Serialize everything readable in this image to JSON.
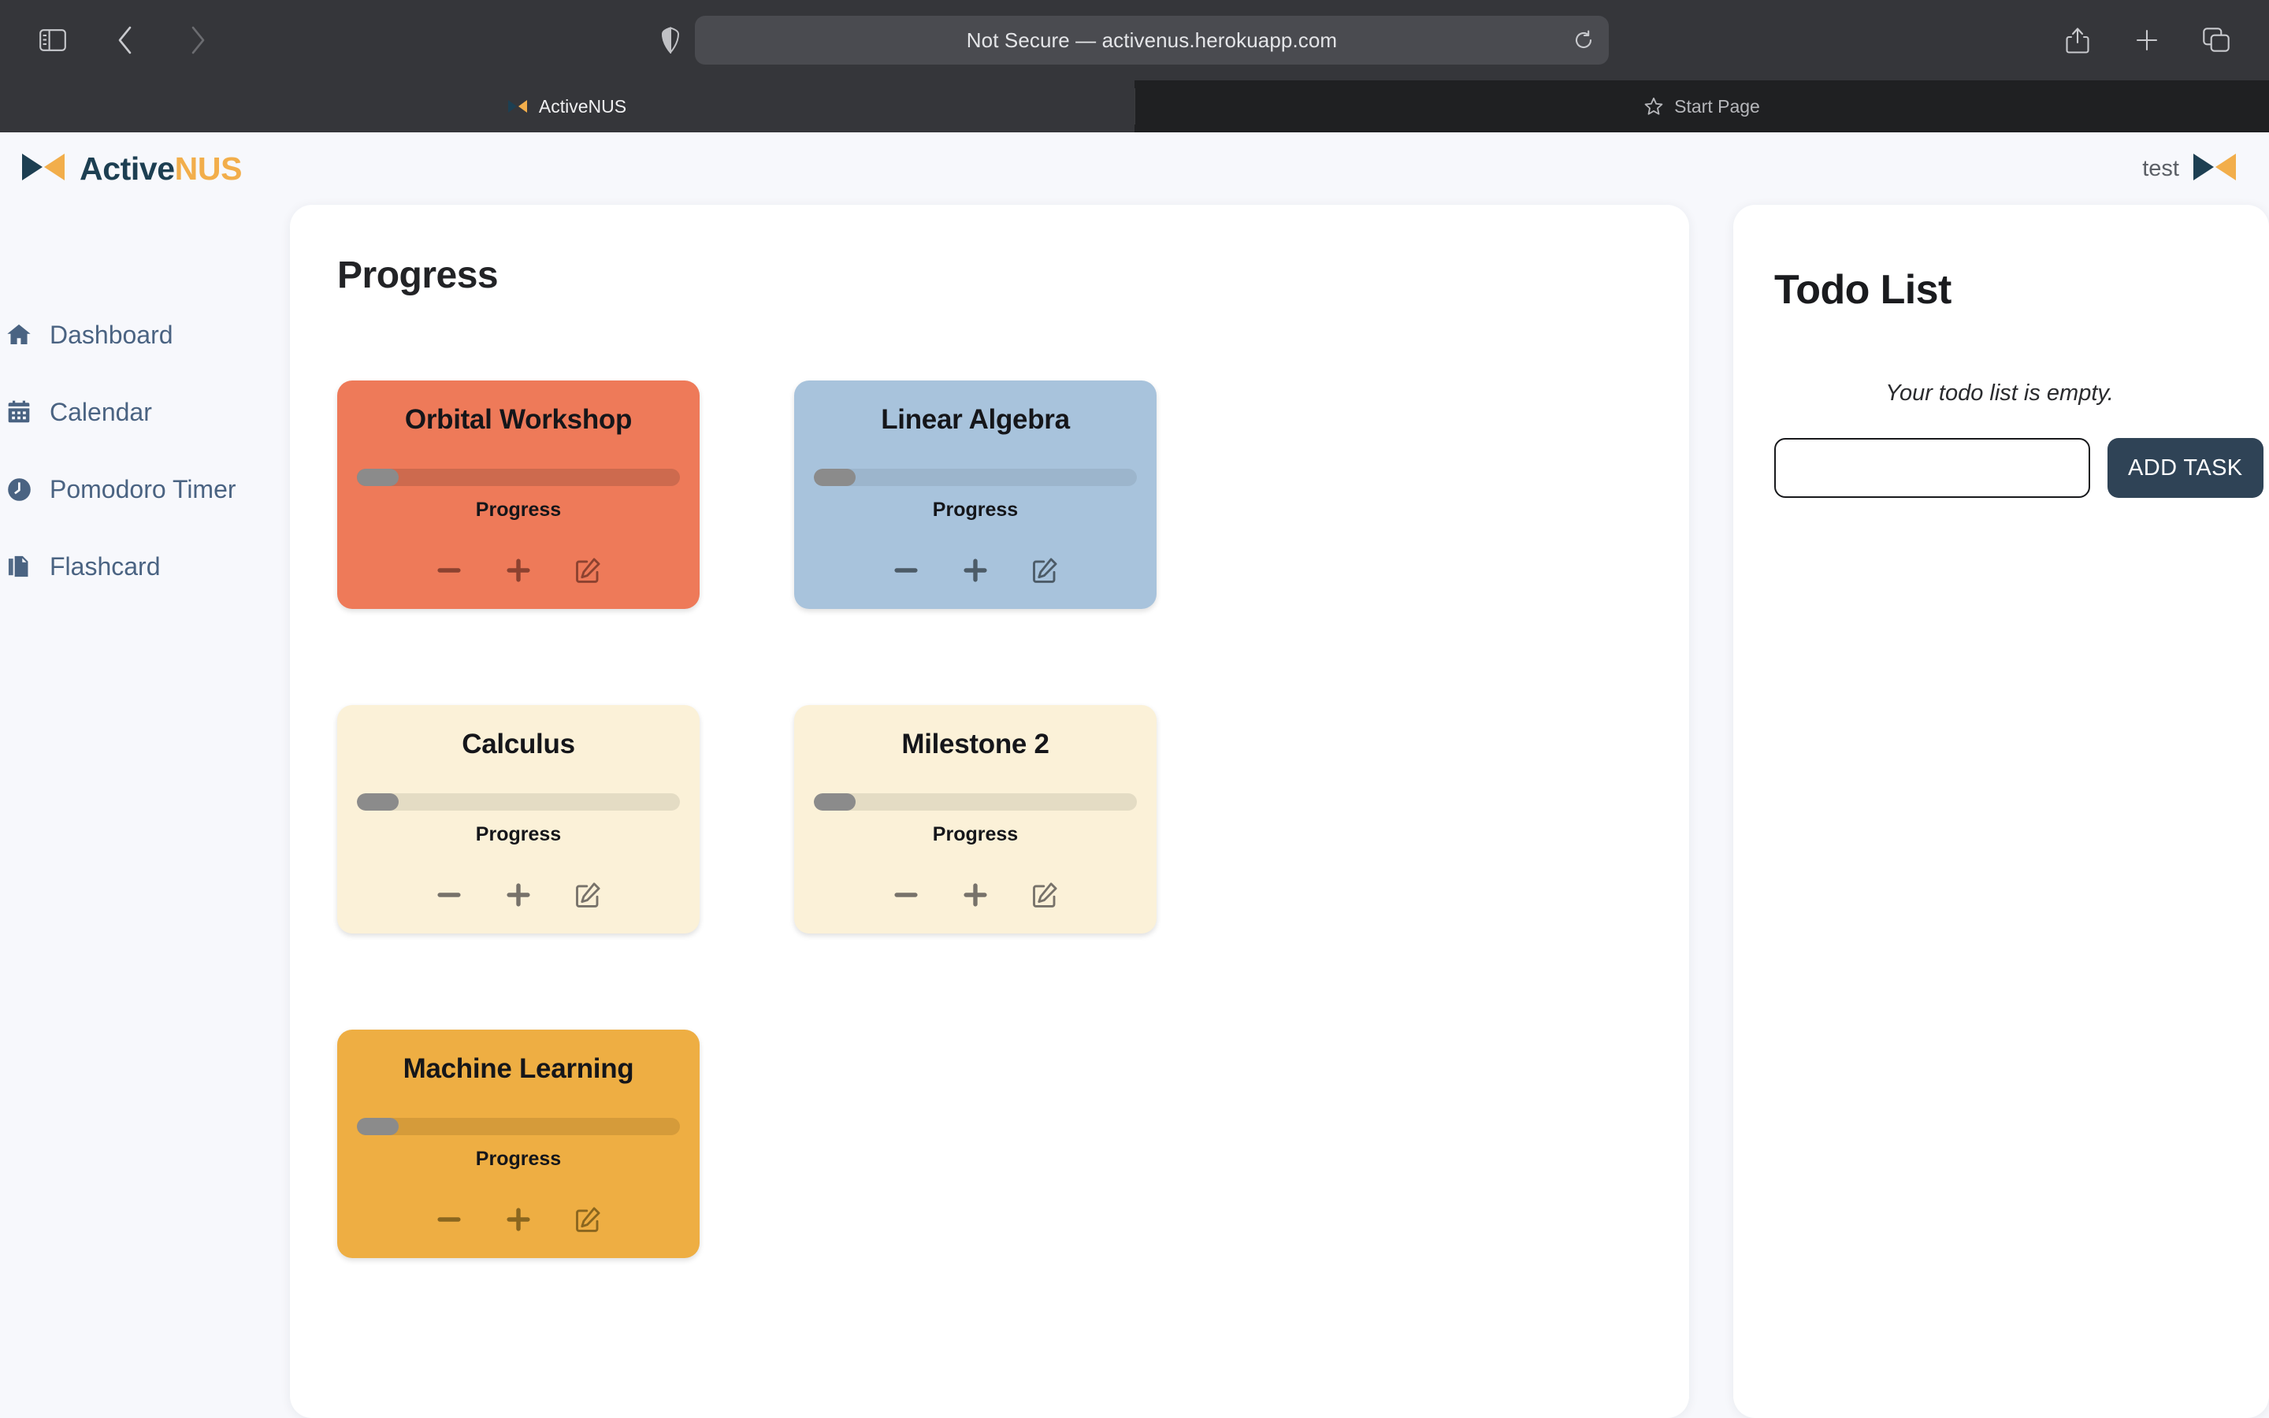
{
  "browser": {
    "toolbar": {
      "sidebar_toggle": "sidebar-toggle",
      "back": "back",
      "forward": "forward",
      "shield": "privacy-shield",
      "url_text": "Not Secure — activenus.herokuapp.com",
      "reload": "reload",
      "share": "share",
      "new_tab": "new-tab",
      "tab_overview": "tab-overview"
    },
    "tabs": [
      {
        "label": "ActiveNUS",
        "active": true,
        "icon": "activenus-favicon"
      },
      {
        "label": "Start Page",
        "active": false,
        "icon": "star-icon"
      }
    ]
  },
  "header": {
    "brand_primary": "Active",
    "brand_accent": "NUS",
    "user_name": "test"
  },
  "sidebar": {
    "items": [
      {
        "label": "Dashboard",
        "icon": "home-icon"
      },
      {
        "label": "Calendar",
        "icon": "calendar-icon"
      },
      {
        "label": "Pomodoro Timer",
        "icon": "clock-icon"
      },
      {
        "label": "Flashcard",
        "icon": "flashcard-icon"
      }
    ]
  },
  "progress_panel": {
    "title": "Progress",
    "progress_label": "Progress",
    "decrement_label": "−",
    "increment_label": "+",
    "edit_label": "edit",
    "cards": [
      {
        "title": "Orbital Workshop",
        "percent": 13,
        "bg": "#ee7a59",
        "track": "#cd6a4e",
        "btn": "#8c4230"
      },
      {
        "title": "Linear Algebra",
        "percent": 13,
        "bg": "#a8c3dc",
        "track": "#9cb5cc",
        "btn": "#4c5b67"
      },
      {
        "title": "Calculus",
        "percent": 13,
        "bg": "#fbf1d8",
        "track": "#e4dcc4",
        "btn": "#77726a"
      },
      {
        "title": "Milestone 2",
        "percent": 13,
        "bg": "#fbf1d8",
        "track": "#e4dcc4",
        "btn": "#77726a"
      },
      {
        "title": "Machine Learning",
        "percent": 13,
        "bg": "#eeae43",
        "track": "#d59b3a",
        "btn": "#8a661f"
      }
    ]
  },
  "todo_panel": {
    "title": "Todo List",
    "empty_message": "Your todo list is empty.",
    "input_value": "",
    "input_placeholder": "",
    "add_button_label": "ADD TASK"
  },
  "colors": {
    "brand_navy": "#1d3f52",
    "brand_orange": "#f2ae4b",
    "page_bg": "#f7f8fc",
    "nav_text": "#4a6382",
    "add_task_bg": "#2f4356"
  }
}
